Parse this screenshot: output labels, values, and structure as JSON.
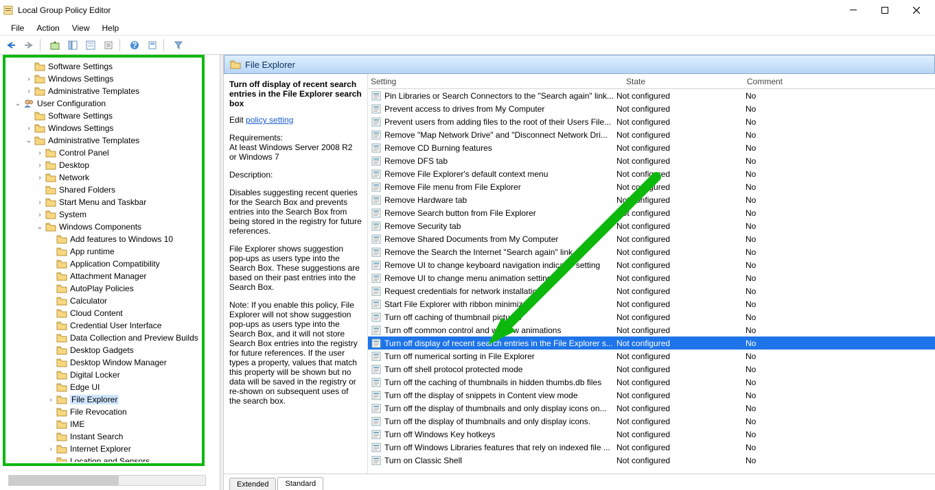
{
  "window": {
    "title": "Local Group Policy Editor"
  },
  "menu": [
    "File",
    "Action",
    "View",
    "Help"
  ],
  "tree": [
    {
      "d": 2,
      "t": "",
      "i": "folder",
      "l": "Software Settings"
    },
    {
      "d": 2,
      "t": ">",
      "i": "folder",
      "l": "Windows Settings"
    },
    {
      "d": 2,
      "t": ">",
      "i": "folder",
      "l": "Administrative Templates"
    },
    {
      "d": 1,
      "t": "v",
      "i": "user",
      "l": "User Configuration"
    },
    {
      "d": 2,
      "t": "",
      "i": "folder",
      "l": "Software Settings"
    },
    {
      "d": 2,
      "t": ">",
      "i": "folder",
      "l": "Windows Settings"
    },
    {
      "d": 2,
      "t": "v",
      "i": "folder",
      "l": "Administrative Templates"
    },
    {
      "d": 3,
      "t": ">",
      "i": "folder",
      "l": "Control Panel"
    },
    {
      "d": 3,
      "t": ">",
      "i": "folder",
      "l": "Desktop"
    },
    {
      "d": 3,
      "t": ">",
      "i": "folder",
      "l": "Network"
    },
    {
      "d": 3,
      "t": "",
      "i": "folder",
      "l": "Shared Folders"
    },
    {
      "d": 3,
      "t": ">",
      "i": "folder",
      "l": "Start Menu and Taskbar"
    },
    {
      "d": 3,
      "t": ">",
      "i": "folder",
      "l": "System"
    },
    {
      "d": 3,
      "t": "v",
      "i": "folder",
      "l": "Windows Components"
    },
    {
      "d": 4,
      "t": "",
      "i": "folder",
      "l": "Add features to Windows 10"
    },
    {
      "d": 4,
      "t": "",
      "i": "folder",
      "l": "App runtime"
    },
    {
      "d": 4,
      "t": "",
      "i": "folder",
      "l": "Application Compatibility"
    },
    {
      "d": 4,
      "t": "",
      "i": "folder",
      "l": "Attachment Manager"
    },
    {
      "d": 4,
      "t": "",
      "i": "folder",
      "l": "AutoPlay Policies"
    },
    {
      "d": 4,
      "t": "",
      "i": "folder",
      "l": "Calculator"
    },
    {
      "d": 4,
      "t": "",
      "i": "folder",
      "l": "Cloud Content"
    },
    {
      "d": 4,
      "t": "",
      "i": "folder",
      "l": "Credential User Interface"
    },
    {
      "d": 4,
      "t": "",
      "i": "folder",
      "l": "Data Collection and Preview Builds"
    },
    {
      "d": 4,
      "t": "",
      "i": "folder",
      "l": "Desktop Gadgets"
    },
    {
      "d": 4,
      "t": "",
      "i": "folder",
      "l": "Desktop Window Manager"
    },
    {
      "d": 4,
      "t": "",
      "i": "folder",
      "l": "Digital Locker"
    },
    {
      "d": 4,
      "t": "",
      "i": "folder",
      "l": "Edge UI"
    },
    {
      "d": 4,
      "t": ">",
      "i": "folder",
      "l": "File Explorer",
      "sel": true
    },
    {
      "d": 4,
      "t": "",
      "i": "folder",
      "l": "File Revocation"
    },
    {
      "d": 4,
      "t": "",
      "i": "folder",
      "l": "IME"
    },
    {
      "d": 4,
      "t": "",
      "i": "folder",
      "l": "Instant Search"
    },
    {
      "d": 4,
      "t": ">",
      "i": "folder",
      "l": "Internet Explorer"
    },
    {
      "d": 4,
      "t": "",
      "i": "folder",
      "l": "Location and Sensors"
    }
  ],
  "breadcrumb": "File Explorer",
  "desc": {
    "title": "Turn off display of recent search entries in the File Explorer search box",
    "editPrefix": "Edit ",
    "editLink": "policy setting ",
    "reqHead": "Requirements:",
    "req": "At least Windows Server 2008 R2 or Windows 7",
    "descHead": "Description:",
    "p1": "Disables suggesting recent queries for the Search Box and prevents entries into the Search Box from being stored in the registry for future references.",
    "p2": "File Explorer shows suggestion pop-ups as users type into the Search Box.  These suggestions are based on their past entries into the Search Box.",
    "p3": "Note: If you enable this policy, File Explorer will not show suggestion pop-ups as users type into the Search Box, and it will not store Search Box entries into the registry for future references.  If the user types a property, values that match this property will be shown but no data will be saved in the registry or re-shown on subsequent uses of the search box."
  },
  "columns": {
    "setting": "Setting",
    "state": "State",
    "comment": "Comment"
  },
  "settings": [
    {
      "name": "Pin Libraries or Search Connectors to the \"Search again\" link...",
      "state": "Not configured",
      "comment": "No"
    },
    {
      "name": "Prevent access to drives from My Computer",
      "state": "Not configured",
      "comment": "No"
    },
    {
      "name": "Prevent users from adding files to the root of their Users File...",
      "state": "Not configured",
      "comment": "No"
    },
    {
      "name": "Remove \"Map Network Drive\" and \"Disconnect Network Dri...",
      "state": "Not configured",
      "comment": "No"
    },
    {
      "name": "Remove CD Burning features",
      "state": "Not configured",
      "comment": "No"
    },
    {
      "name": "Remove DFS tab",
      "state": "Not configured",
      "comment": "No"
    },
    {
      "name": "Remove File Explorer's default context menu",
      "state": "Not configured",
      "comment": "No"
    },
    {
      "name": "Remove File menu from File Explorer",
      "state": "Not configured",
      "comment": "No"
    },
    {
      "name": "Remove Hardware tab",
      "state": "Not configured",
      "comment": "No"
    },
    {
      "name": "Remove Search button from File Explorer",
      "state": "Not configured",
      "comment": "No"
    },
    {
      "name": "Remove Security tab",
      "state": "Not configured",
      "comment": "No"
    },
    {
      "name": "Remove Shared Documents from My Computer",
      "state": "Not configured",
      "comment": "No"
    },
    {
      "name": "Remove the Search the Internet \"Search again\" link",
      "state": "Not configured",
      "comment": "No"
    },
    {
      "name": "Remove UI to change keyboard navigation indicator setting",
      "state": "Not configured",
      "comment": "No"
    },
    {
      "name": "Remove UI to change menu animation setting",
      "state": "Not configured",
      "comment": "No"
    },
    {
      "name": "Request credentials for network installations",
      "state": "Not configured",
      "comment": "No"
    },
    {
      "name": "Start File Explorer with ribbon minimized",
      "state": "Not configured",
      "comment": "No"
    },
    {
      "name": "Turn off caching of thumbnail pictures",
      "state": "Not configured",
      "comment": "No"
    },
    {
      "name": "Turn off common control and window animations",
      "state": "Not configured",
      "comment": "No"
    },
    {
      "name": "Turn off display of recent search entries in the File Explorer s...",
      "state": "Not configured",
      "comment": "No",
      "sel": true
    },
    {
      "name": "Turn off numerical sorting in File Explorer",
      "state": "Not configured",
      "comment": "No"
    },
    {
      "name": "Turn off shell protocol protected mode",
      "state": "Not configured",
      "comment": "No"
    },
    {
      "name": "Turn off the caching of thumbnails in hidden thumbs.db files",
      "state": "Not configured",
      "comment": "No"
    },
    {
      "name": "Turn off the display of snippets in Content view mode",
      "state": "Not configured",
      "comment": "No"
    },
    {
      "name": "Turn off the display of thumbnails and only display icons on...",
      "state": "Not configured",
      "comment": "No"
    },
    {
      "name": "Turn off the display of thumbnails and only display icons.",
      "state": "Not configured",
      "comment": "No"
    },
    {
      "name": "Turn off Windows Key hotkeys",
      "state": "Not configured",
      "comment": "No"
    },
    {
      "name": "Turn off Windows Libraries features that rely on indexed file ...",
      "state": "Not configured",
      "comment": "No"
    },
    {
      "name": "Turn on Classic Shell",
      "state": "Not configured",
      "comment": "No"
    }
  ],
  "tabs": {
    "extended": "Extended",
    "standard": "Standard"
  }
}
